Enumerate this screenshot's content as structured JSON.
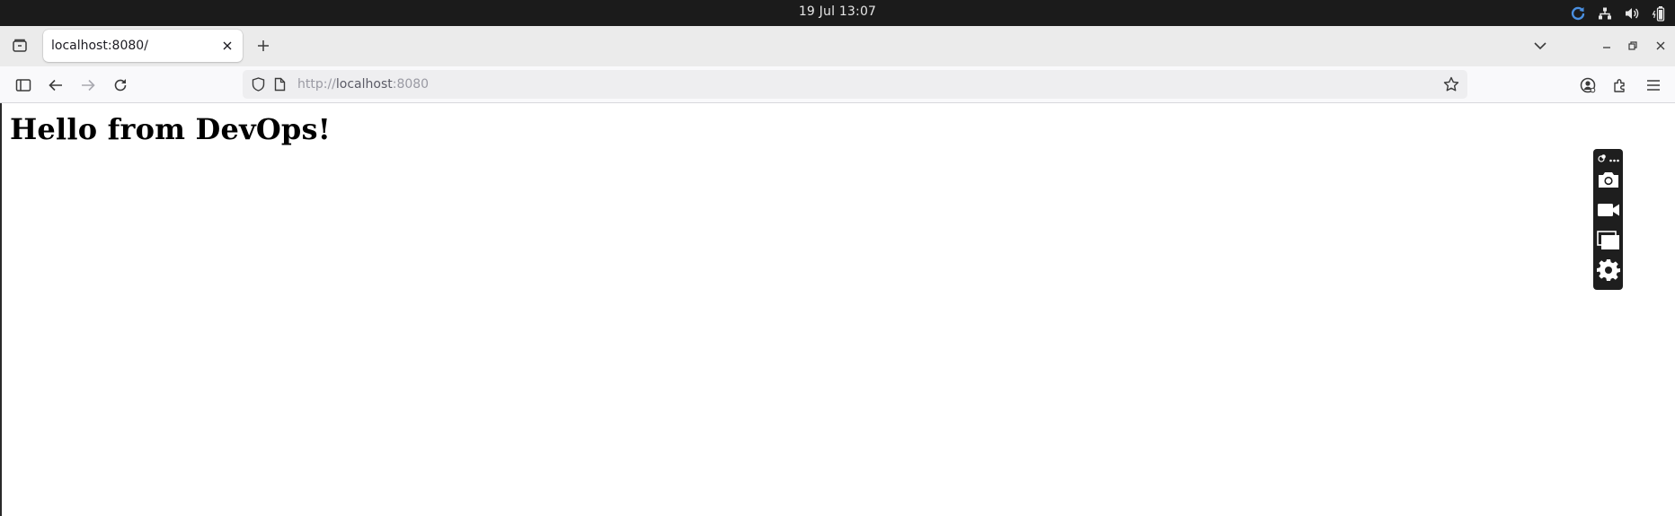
{
  "os_bar": {
    "clock": "19 Jul  13:07",
    "tray_icons": [
      "refresh-status-icon",
      "network-icon",
      "volume-icon",
      "battery-icon"
    ]
  },
  "browser": {
    "tab": {
      "title": "localhost:8080/"
    },
    "address": {
      "scheme": "http://",
      "host": "localhost",
      "port": ":8080"
    },
    "toolbar_icons": [
      "sidebar-icon",
      "back-arrow-icon",
      "forward-arrow-icon",
      "reload-icon",
      "bookmark-star-icon",
      "account-icon",
      "extensions-icon",
      "menu-icon"
    ]
  },
  "page": {
    "heading": "Hello from DevOps!"
  },
  "capture_toolbar": {
    "items": [
      "screenshot-camera-icon",
      "video-record-icon",
      "window-capture-icon",
      "settings-gear-icon"
    ]
  },
  "colors": {
    "os_bar_bg": "#1b1b1b",
    "tabstrip_bg": "#ebebeb",
    "navbar_bg": "#f9f9fb",
    "urlbar_bg": "#eeeef0",
    "capture_bar_bg": "#1e1e1e"
  }
}
